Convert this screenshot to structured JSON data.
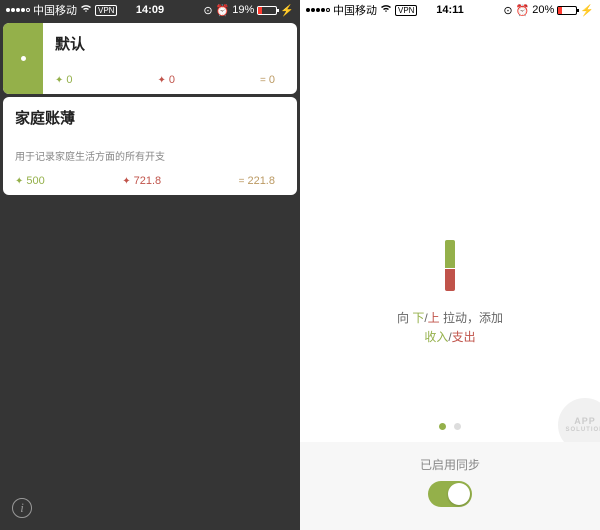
{
  "left": {
    "status": {
      "carrier": "中国移动",
      "wifi_icon": "wifi-icon",
      "vpn": "VPN",
      "time": "14:09",
      "alarm": "⏰",
      "battery_pct": "19%"
    },
    "default_card": {
      "title": "默认",
      "income": "0",
      "expense": "0",
      "balance": "0"
    },
    "family_card": {
      "title": "家庭账薄",
      "subtitle": "用于记录家庭生活方面的所有开支",
      "income": "500",
      "expense": "721.8",
      "balance": "221.8"
    }
  },
  "right": {
    "status": {
      "carrier": "中国移动",
      "time": "14:11",
      "battery_pct": "20%"
    },
    "hint": {
      "prefix": "向 ",
      "down": "下",
      "slash1": "/",
      "up": "上",
      "mid": " 拉动，添加",
      "income": "收入",
      "slash2": "/",
      "expense": "支出"
    },
    "sync": {
      "label": "已启用同步",
      "enabled": true
    },
    "watermark": {
      "l1": "APP",
      "l2": "SOLUTION"
    }
  }
}
